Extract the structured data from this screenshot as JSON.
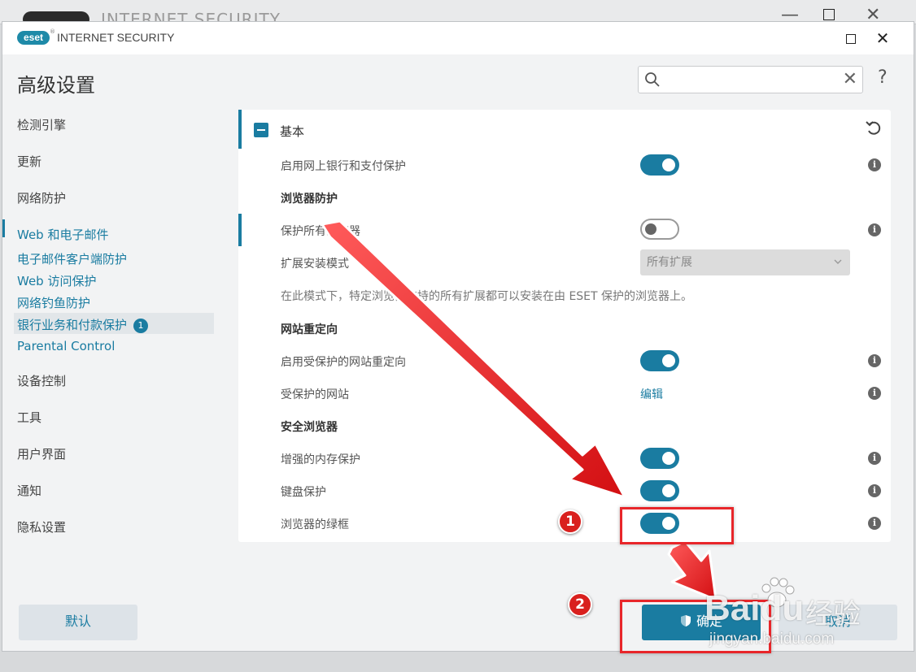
{
  "background_window": {
    "title": "INTERNET SECURITY",
    "minimize": "—",
    "close": "✕"
  },
  "window": {
    "logo": "eset",
    "title": "INTERNET SECURITY",
    "close": "✕"
  },
  "page_title": "高级设置",
  "search": {
    "value": "",
    "placeholder": "",
    "clear": "✕"
  },
  "help": "?",
  "sidebar": {
    "items": [
      {
        "label": "检测引擎"
      },
      {
        "label": "更新"
      },
      {
        "label": "网络防护"
      },
      {
        "label": "Web 和电子邮件"
      },
      {
        "label": "设备控制"
      },
      {
        "label": "工具"
      },
      {
        "label": "用户界面"
      },
      {
        "label": "通知"
      },
      {
        "label": "隐私设置"
      }
    ],
    "subitems": [
      {
        "label": "电子邮件客户端防护"
      },
      {
        "label": "Web 访问保护"
      },
      {
        "label": "网络钓鱼防护"
      },
      {
        "label": "银行业务和付款保护",
        "badge": "1"
      },
      {
        "label": "Parental Control"
      }
    ]
  },
  "panel": {
    "section_title": "基本",
    "rows": {
      "banking": {
        "label": "启用网上银行和支付保护",
        "on": true
      },
      "browser_group": "浏览器防护",
      "protect_all": {
        "label": "保护所有浏览器",
        "on": false
      },
      "ext_mode": {
        "label": "扩展安装模式",
        "value": "所有扩展"
      },
      "ext_desc": "在此模式下，特定浏览器支持的所有扩展都可以安装在由 ESET 保护的浏览器上。",
      "redirect_group": "网站重定向",
      "redirect": {
        "label": "启用受保护的网站重定向",
        "on": true
      },
      "protected_sites": {
        "label": "受保护的网站",
        "link": "编辑"
      },
      "secure_group": "安全浏览器",
      "memory": {
        "label": "增强的内存保护",
        "on": true
      },
      "keyboard": {
        "label": "键盘保护",
        "on": true
      },
      "green_frame": {
        "label": "浏览器的绿框",
        "on": true
      }
    },
    "info": "i"
  },
  "buttons": {
    "default": "默认",
    "ok": "确定",
    "cancel": "取消"
  },
  "annotations": {
    "one": "1",
    "two": "2"
  },
  "watermark": {
    "brand": "Baidu",
    "cn": "经验",
    "url": "jingyan.baidu.com"
  },
  "colors": {
    "accent": "#1a7ca1",
    "annotation": "#e8262a"
  }
}
